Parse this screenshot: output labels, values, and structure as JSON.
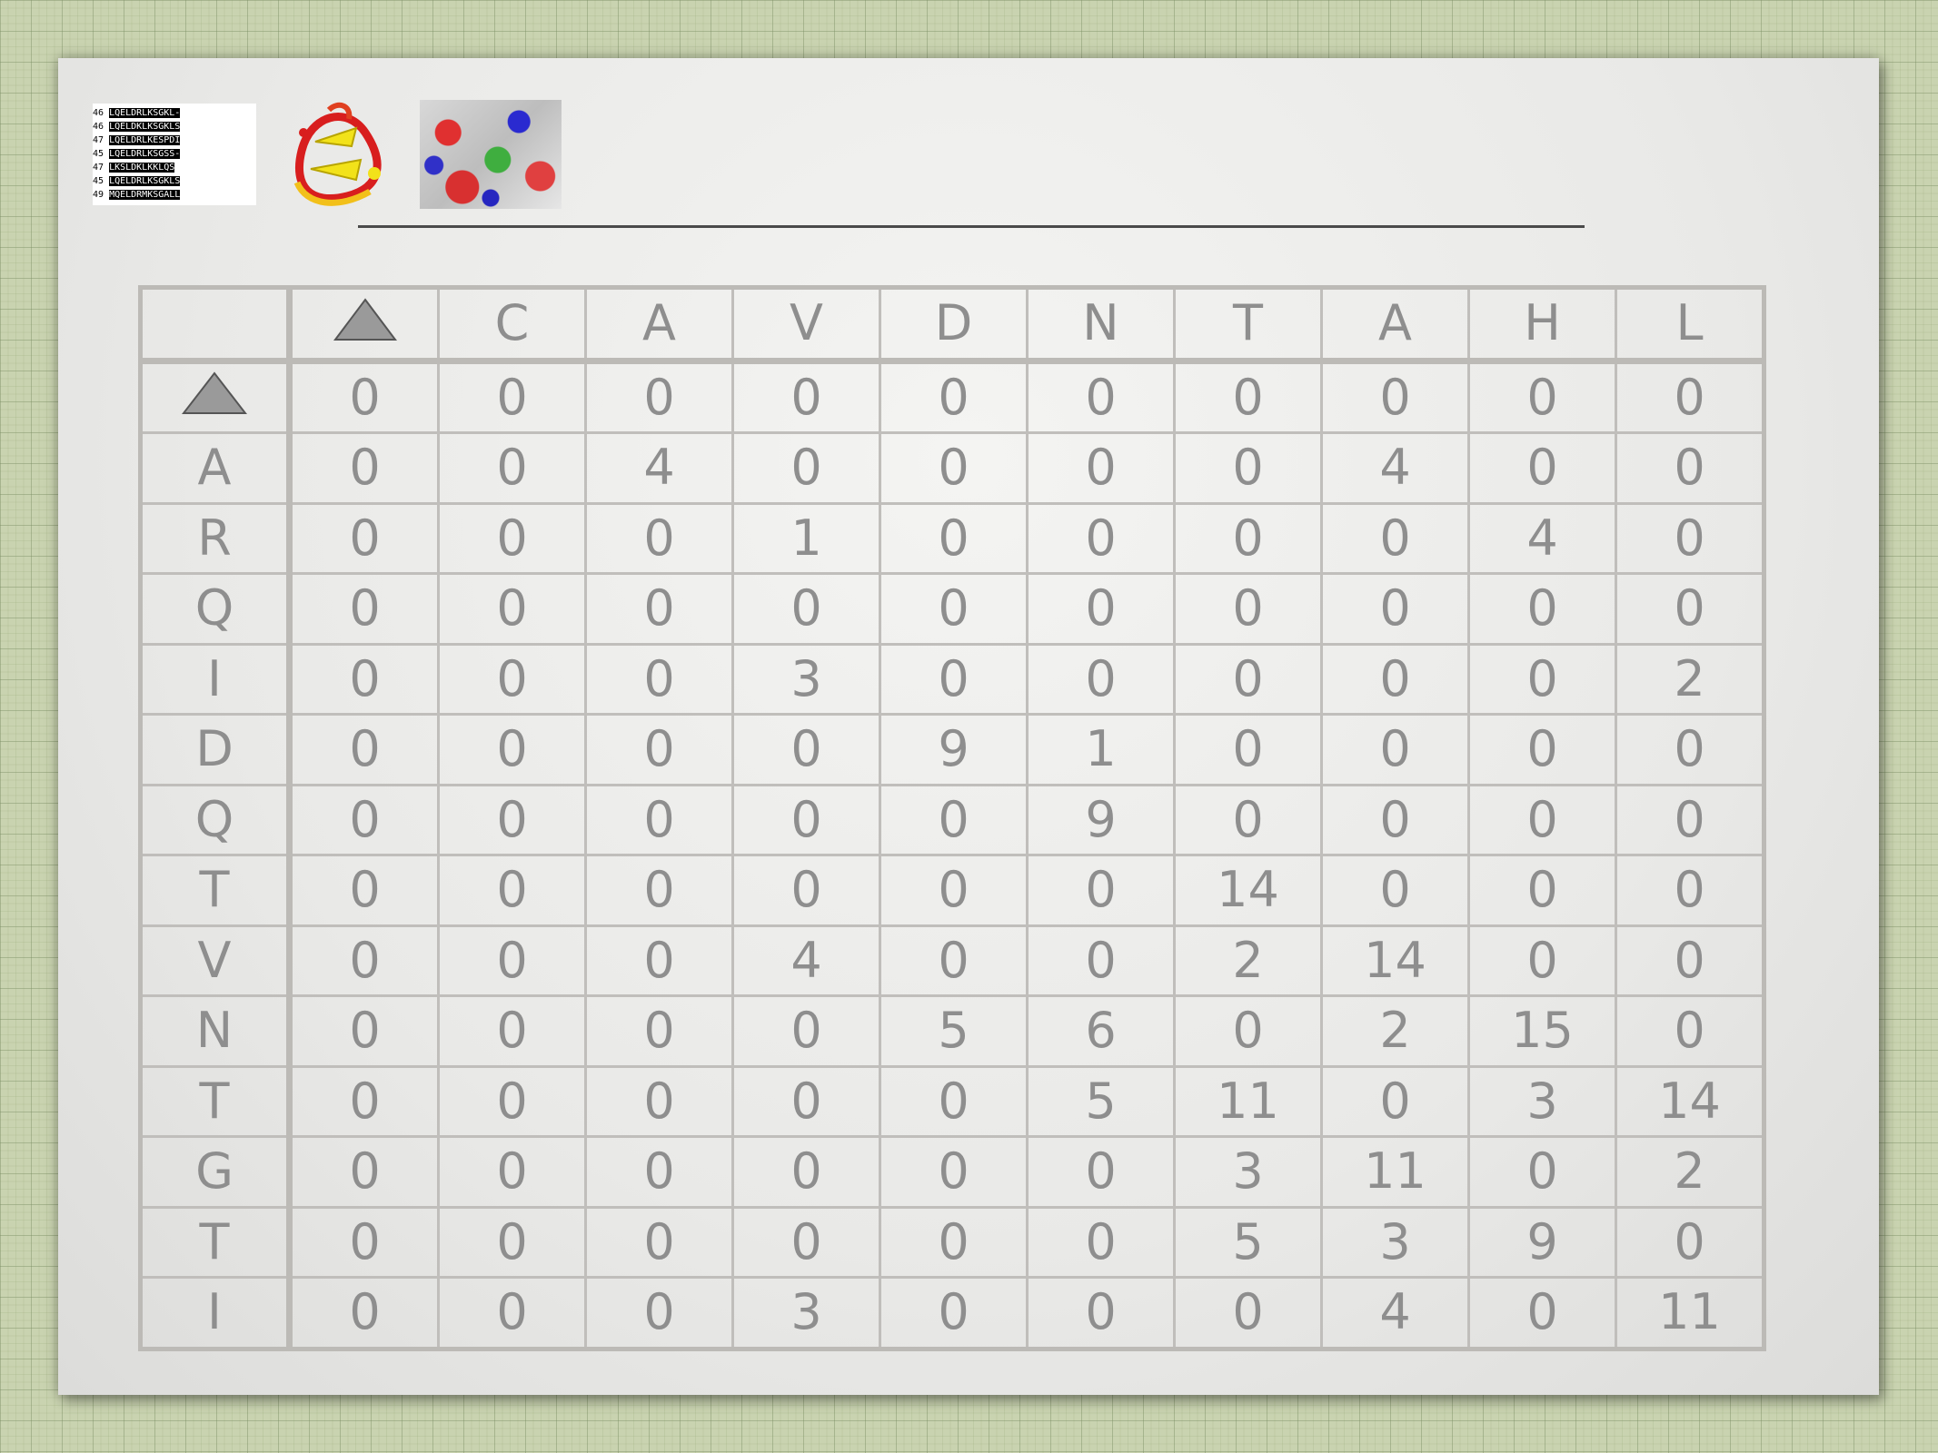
{
  "matrix": {
    "gap_symbol": "gap-triangle-icon",
    "column_headers": [
      "",
      "C",
      "A",
      "V",
      "D",
      "N",
      "T",
      "A",
      "H",
      "L"
    ],
    "rows": [
      {
        "label": "",
        "values": [
          "0",
          "0",
          "0",
          "0",
          "0",
          "0",
          "0",
          "0",
          "0",
          "0"
        ]
      },
      {
        "label": "A",
        "values": [
          "0",
          "0",
          "4",
          "0",
          "0",
          "0",
          "0",
          "4",
          "0",
          "0"
        ]
      },
      {
        "label": "R",
        "values": [
          "0",
          "0",
          "0",
          "1",
          "0",
          "0",
          "0",
          "0",
          "4",
          "0"
        ]
      },
      {
        "label": "Q",
        "values": [
          "0",
          "0",
          "0",
          "0",
          "0",
          "0",
          "0",
          "0",
          "0",
          "0"
        ]
      },
      {
        "label": "I",
        "values": [
          "0",
          "0",
          "0",
          "3",
          "0",
          "0",
          "0",
          "0",
          "0",
          "2"
        ]
      },
      {
        "label": "D",
        "values": [
          "0",
          "0",
          "0",
          "0",
          "9",
          "1",
          "0",
          "0",
          "0",
          "0"
        ]
      },
      {
        "label": "Q",
        "values": [
          "0",
          "0",
          "0",
          "0",
          "0",
          "9",
          "0",
          "0",
          "0",
          "0"
        ]
      },
      {
        "label": "T",
        "values": [
          "0",
          "0",
          "0",
          "0",
          "0",
          "0",
          "14",
          "0",
          "0",
          "0"
        ]
      },
      {
        "label": "V",
        "values": [
          "0",
          "0",
          "0",
          "4",
          "0",
          "0",
          "2",
          "14",
          "0",
          "0"
        ]
      },
      {
        "label": "N",
        "values": [
          "0",
          "0",
          "0",
          "0",
          "5",
          "6",
          "0",
          "2",
          "15",
          "0"
        ]
      },
      {
        "label": "T",
        "values": [
          "0",
          "0",
          "0",
          "0",
          "0",
          "5",
          "11",
          "0",
          "3",
          "14"
        ]
      },
      {
        "label": "G",
        "values": [
          "0",
          "0",
          "0",
          "0",
          "0",
          "0",
          "3",
          "11",
          "0",
          "2"
        ]
      },
      {
        "label": "T",
        "values": [
          "0",
          "0",
          "0",
          "0",
          "0",
          "0",
          "5",
          "3",
          "9",
          "0"
        ]
      },
      {
        "label": "I",
        "values": [
          "0",
          "0",
          "0",
          "3",
          "0",
          "0",
          "0",
          "4",
          "0",
          "11"
        ]
      }
    ]
  },
  "thumbnails": {
    "alignment_lines": [
      "46 LQELDRLKSGKL-",
      "46 LQELDKLKSGKLS",
      "47 LQELDRLKESPDI",
      "45 LQELDRLKSGSS-",
      "47 LKSLDKLKKLQS",
      "45 LQELDRLKSGKLS",
      "49 MQELDRMKSGALL"
    ],
    "colors": {
      "ribbon_red": "#d81e1e",
      "ribbon_yellow": "#f2e21a",
      "text_gray": "#8e8e8e"
    }
  }
}
